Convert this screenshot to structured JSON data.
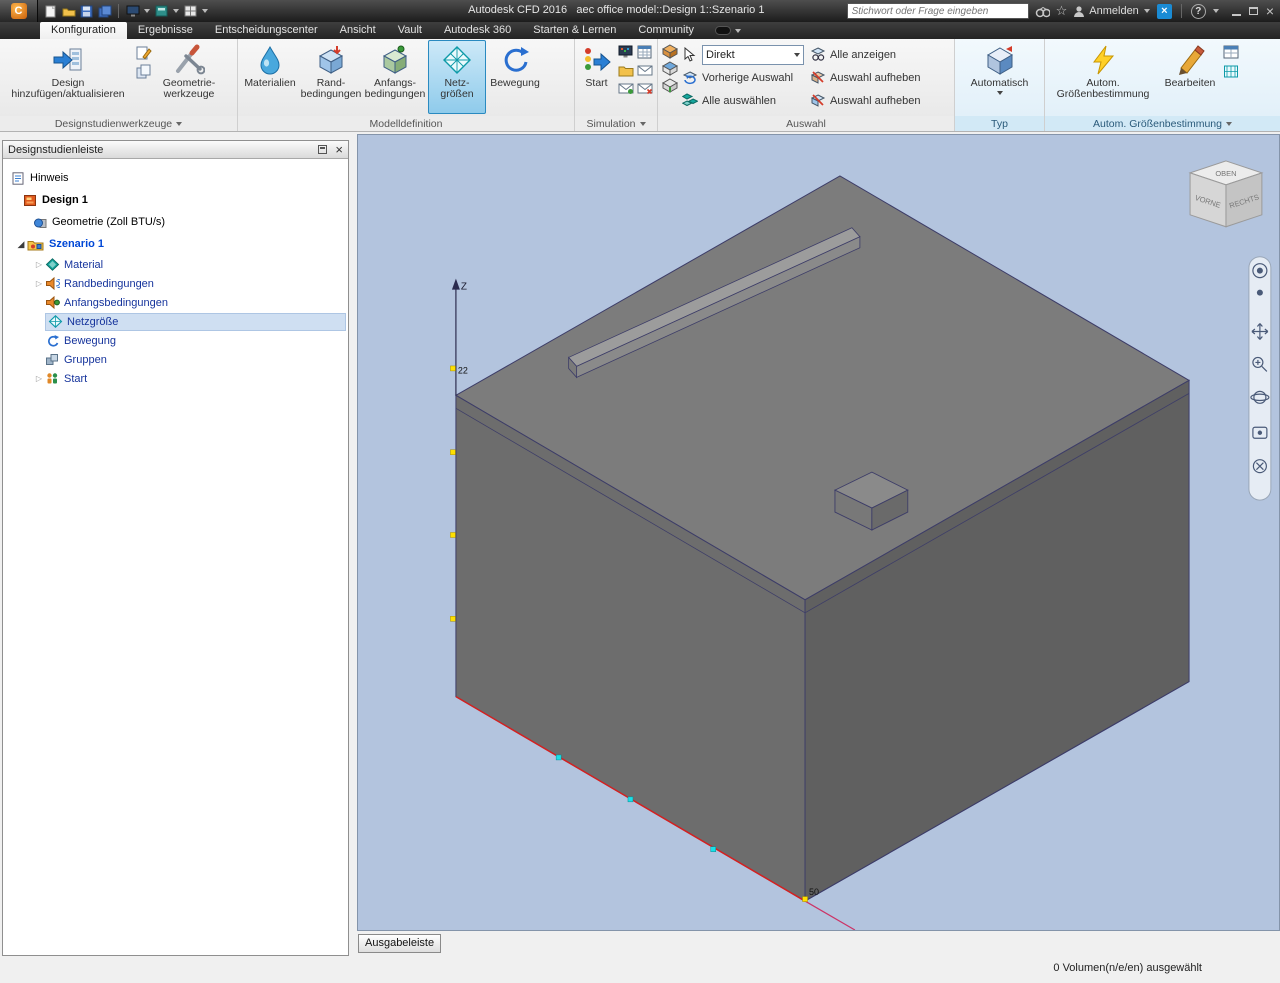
{
  "titlebar": {
    "title": "Autodesk CFD 2016   aec office model::Design 1::Szenario 1",
    "search_placeholder": "Stichwort oder Frage eingeben",
    "signin": "Anmelden",
    "help": "?"
  },
  "tabs": {
    "items": [
      {
        "label": "Konfiguration"
      },
      {
        "label": "Ergebnisse"
      },
      {
        "label": "Entscheidungscenter"
      },
      {
        "label": "Ansicht"
      },
      {
        "label": "Vault"
      },
      {
        "label": "Autodesk 360"
      },
      {
        "label": "Starten & Lernen"
      },
      {
        "label": "Community"
      }
    ]
  },
  "ribbon": {
    "group_labels": [
      {
        "label": "Designstudienwerkzeuge"
      },
      {
        "label": "Modelldefinition"
      },
      {
        "label": "Simulation"
      },
      {
        "label": "Auswahl"
      },
      {
        "label": "Typ"
      },
      {
        "label": "Autom. Größenbestimmung"
      }
    ],
    "add_design": "Design hinzufügen/aktualisieren",
    "geometry_tools": "Geometrie-werkzeuge",
    "materials": "Materialien",
    "boundary_conditions": "Rand-bedingungen",
    "initial_conditions": "Anfangs-bedingungen",
    "mesh_sizes": "Netz-größen",
    "motion": "Bewegung",
    "start": "Start",
    "selection_mode": "Direkt",
    "previous_selection": "Vorherige Auswahl",
    "select_all": "Alle auswählen",
    "show_all": "Alle anzeigen",
    "deselect_1": "Auswahl aufheben",
    "deselect_2": "Auswahl aufheben",
    "type_automatic": "Automatisch",
    "auto_sizing": "Autom. Größenbestimmung",
    "edit": "Bearbeiten"
  },
  "sidebar": {
    "title": "Designstudienleiste",
    "items": [
      {
        "label": "Hinweis"
      },
      {
        "label": "Design 1"
      },
      {
        "label": "Geometrie (Zoll BTU/s)"
      },
      {
        "label": "Szenario 1"
      },
      {
        "label": "Material"
      },
      {
        "label": "Randbedingungen"
      },
      {
        "label": "Anfangsbedingungen"
      },
      {
        "label": "Netzgröße"
      },
      {
        "label": "Bewegung"
      },
      {
        "label": "Gruppen"
      },
      {
        "label": "Start"
      }
    ]
  },
  "viewport": {
    "viewcube": {
      "top": "OBEN",
      "front": "VORNE",
      "right": "RECHTS"
    },
    "z_axis_label": "Z",
    "mesh_count_z": "22",
    "mesh_count_x": "50",
    "output_bar_button": "Ausgabeleiste"
  },
  "statusbar": {
    "selection_info": "0 Volumen(n/e/en) ausgewählt"
  },
  "colors": {
    "viewport_bg": "#b3c4de",
    "model_gray": "#6d6d6d",
    "edge_navy": "#3d3d68",
    "axis_red": "#d42020",
    "marker_yellow": "#ffe000",
    "marker_cyan": "#19e0e8",
    "active_tool_blue": "#8fcbeb"
  }
}
